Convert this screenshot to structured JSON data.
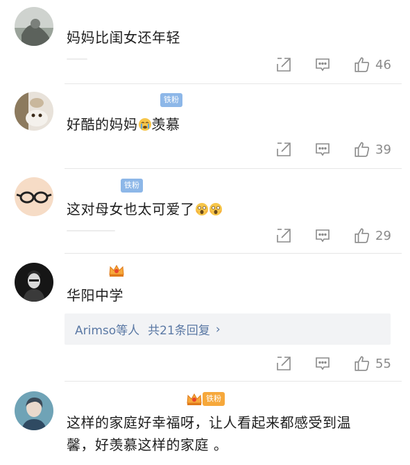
{
  "comments": [
    {
      "text": "妈妈比闺女还年轻",
      "likes": "46"
    },
    {
      "badge": "铁粉",
      "text": "好酷的妈妈",
      "text_after": "羡慕",
      "emoji": "crying-face",
      "likes": "39"
    },
    {
      "badge": "铁粉",
      "text": "这对母女也太可爱了",
      "emoji": "screaming-face x2",
      "likes": "29"
    },
    {
      "text": "华阳中学",
      "reply_users": "Arimso等人",
      "reply_count": "共21条回复",
      "reply_arrow": "›",
      "likes": "55"
    },
    {
      "badge": "铁粉",
      "text_line1": "这样的家庭好幸福呀，让人看起来都感受到温",
      "text_line2": "馨，好羡慕这样的家庭 。"
    }
  ],
  "colors": {
    "badge_blue": "#8db7e8",
    "badge_orange": "#f6a83b",
    "link": "#5a78a4",
    "icon_gray": "#8a8a8a"
  },
  "icons": [
    "share-icon",
    "comment-icon",
    "like-icon",
    "crown-icon"
  ]
}
